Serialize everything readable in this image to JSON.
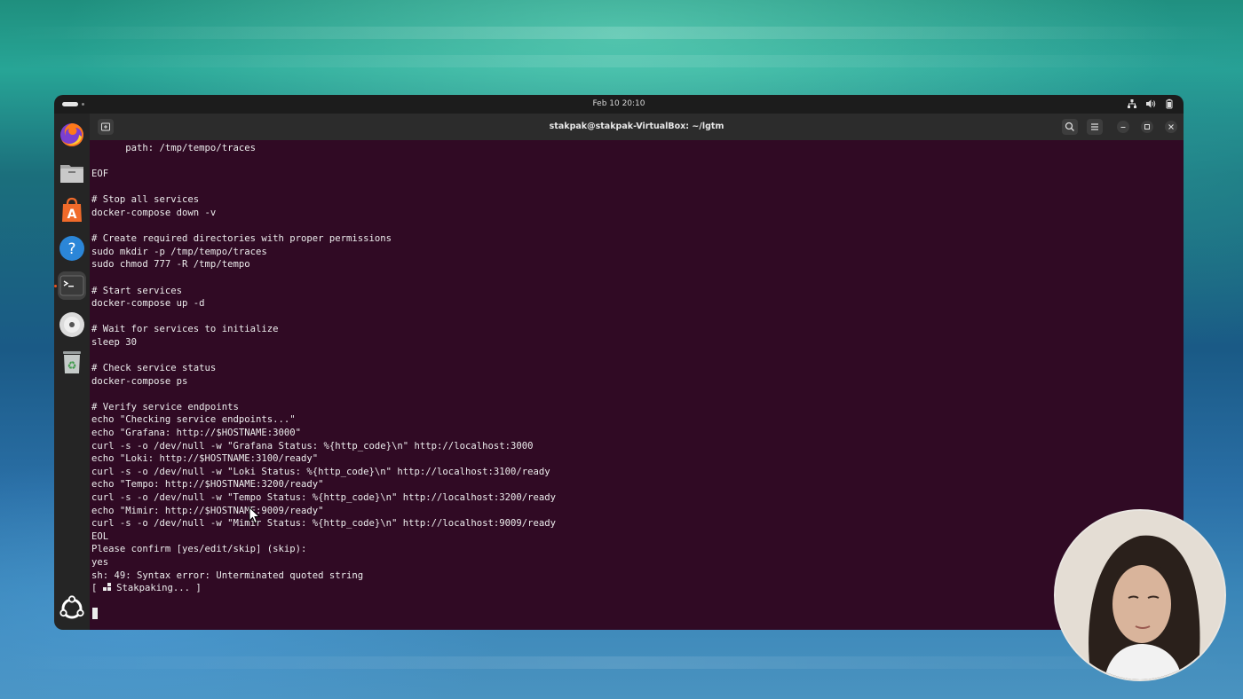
{
  "system": {
    "clock": "Feb 10  20:10"
  },
  "dock": {
    "items": [
      "firefox-icon",
      "files-icon",
      "app-center-icon",
      "help-icon",
      "terminal-icon",
      "disc-icon",
      "trash-icon",
      "show-apps-icon"
    ]
  },
  "window": {
    "title": "stakpak@stakpak-VirtualBox: ~/lgtm"
  },
  "terminal": {
    "lines": [
      "      path: /tmp/tempo/traces",
      "",
      "EOF",
      "",
      "# Stop all services",
      "docker-compose down -v",
      "",
      "# Create required directories with proper permissions",
      "sudo mkdir -p /tmp/tempo/traces",
      "sudo chmod 777 -R /tmp/tempo",
      "",
      "# Start services",
      "docker-compose up -d",
      "",
      "# Wait for services to initialize",
      "sleep 30",
      "",
      "# Check service status",
      "docker-compose ps",
      "",
      "# Verify service endpoints",
      "echo \"Checking service endpoints...\"",
      "echo \"Grafana: http://$HOSTNAME:3000\"",
      "curl -s -o /dev/null -w \"Grafana Status: %{http_code}\\n\" http://localhost:3000",
      "echo \"Loki: http://$HOSTNAME:3100/ready\"",
      "curl -s -o /dev/null -w \"Loki Status: %{http_code}\\n\" http://localhost:3100/ready",
      "echo \"Tempo: http://$HOSTNAME:3200/ready\"",
      "curl -s -o /dev/null -w \"Tempo Status: %{http_code}\\n\" http://localhost:3200/ready",
      "echo \"Mimir: http://$HOSTNAME:9009/ready\"",
      "curl -s -o /dev/null -w \"Mimir Status: %{http_code}\\n\" http://localhost:9009/ready",
      "EOL",
      "Please confirm [yes/edit/skip] (skip):",
      "yes",
      "sh: 49: Syntax error: Unterminated quoted string"
    ],
    "spinner_prefix": "[ ",
    "spinner_text": " Stakpaking... ]"
  }
}
